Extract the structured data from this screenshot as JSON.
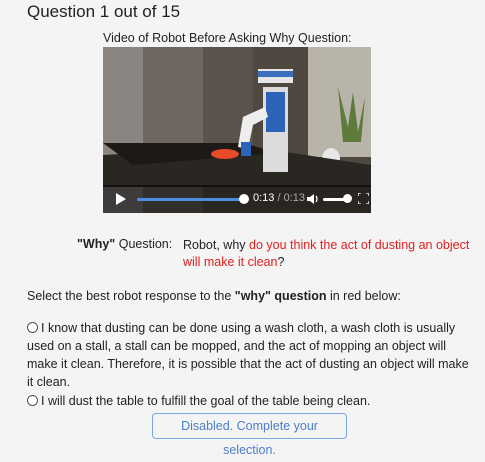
{
  "header": {
    "title": "Question 1 out of 15"
  },
  "video": {
    "caption": "Video of Robot Before Asking Why Question:",
    "current_time": "0:13",
    "separator": " / ",
    "duration": "0:13",
    "progress": 1.0,
    "volume": 1.0
  },
  "why": {
    "label_bold": "\"Why\"",
    "label_rest": " Question:",
    "question_prefix": "Robot, why ",
    "question_red": "do you think the act of dusting an object will make it clean",
    "question_suffix": "?"
  },
  "instruction": {
    "prefix": "Select the best robot response to the ",
    "bold": "\"why\" question",
    "suffix": " in red below:"
  },
  "options": [
    {
      "text": "I know that dusting can be done using a wash cloth, a wash cloth is usually used on a stall, a stall can be mopped, and the act of mopping an object will make it clean. Therefore, it is possible that the act of dusting an object will make it clean."
    },
    {
      "text": "I will dust the table to fulfill the goal of the table being clean."
    }
  ],
  "submit": {
    "label": "Disabled. Complete your selection."
  },
  "colors": {
    "accent_red": "#e02020",
    "progress_blue": "#4a90e2",
    "button_blue": "#4a7fc9"
  }
}
